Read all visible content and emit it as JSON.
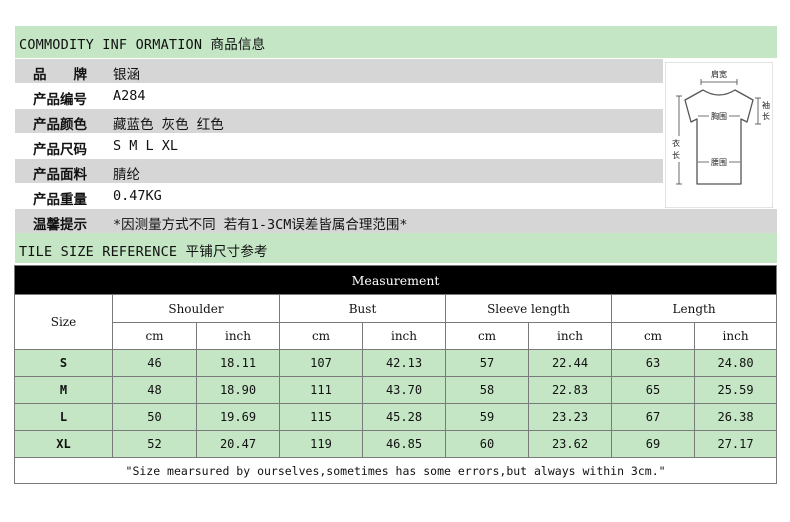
{
  "header": {
    "title": "COMMODITY INF ORMATION 商品信息"
  },
  "info": [
    {
      "label": "品　　牌",
      "value": "银涵"
    },
    {
      "label": "产品编号",
      "value": "A284"
    },
    {
      "label": "产品颜色",
      "value": "藏蓝色 灰色 红色"
    },
    {
      "label": "产品尺码",
      "value": "S M L XL"
    },
    {
      "label": "产品面料",
      "value": "腈纶"
    },
    {
      "label": "产品重量",
      "value": "0.47KG"
    },
    {
      "label": "温馨提示",
      "value": "*因测量方式不同 若有1-3CM误差皆属合理范围*"
    }
  ],
  "diagram": {
    "shoulder_label": "肩宽",
    "chest_label": "胸围",
    "waist_label": "腰围",
    "sleeve_label_1": "袖",
    "sleeve_label_2": "长",
    "length_label_1": "衣",
    "length_label_2": "长"
  },
  "tile": {
    "title": "TILE SIZE REFERENCE 平铺尺寸参考"
  },
  "table": {
    "caption": "Measurement",
    "size_header": "Size",
    "groups": [
      "Shoulder",
      "Bust",
      "Sleeve length",
      "Length"
    ],
    "units": [
      "cm",
      "inch",
      "cm",
      "inch",
      "cm",
      "inch",
      "cm",
      "inch"
    ],
    "rows": [
      {
        "size": "S",
        "values": [
          "46",
          "18.11",
          "107",
          "42.13",
          "57",
          "22.44",
          "63",
          "24.80"
        ]
      },
      {
        "size": "M",
        "values": [
          "48",
          "18.90",
          "111",
          "43.70",
          "58",
          "22.83",
          "65",
          "25.59"
        ]
      },
      {
        "size": "L",
        "values": [
          "50",
          "19.69",
          "115",
          "45.28",
          "59",
          "23.23",
          "67",
          "26.38"
        ]
      },
      {
        "size": "XL",
        "values": [
          "52",
          "20.47",
          "119",
          "46.85",
          "60",
          "23.62",
          "69",
          "27.17"
        ]
      }
    ],
    "note": "\"Size mearsured by ourselves,sometimes has some errors,but always within 3cm.\""
  }
}
